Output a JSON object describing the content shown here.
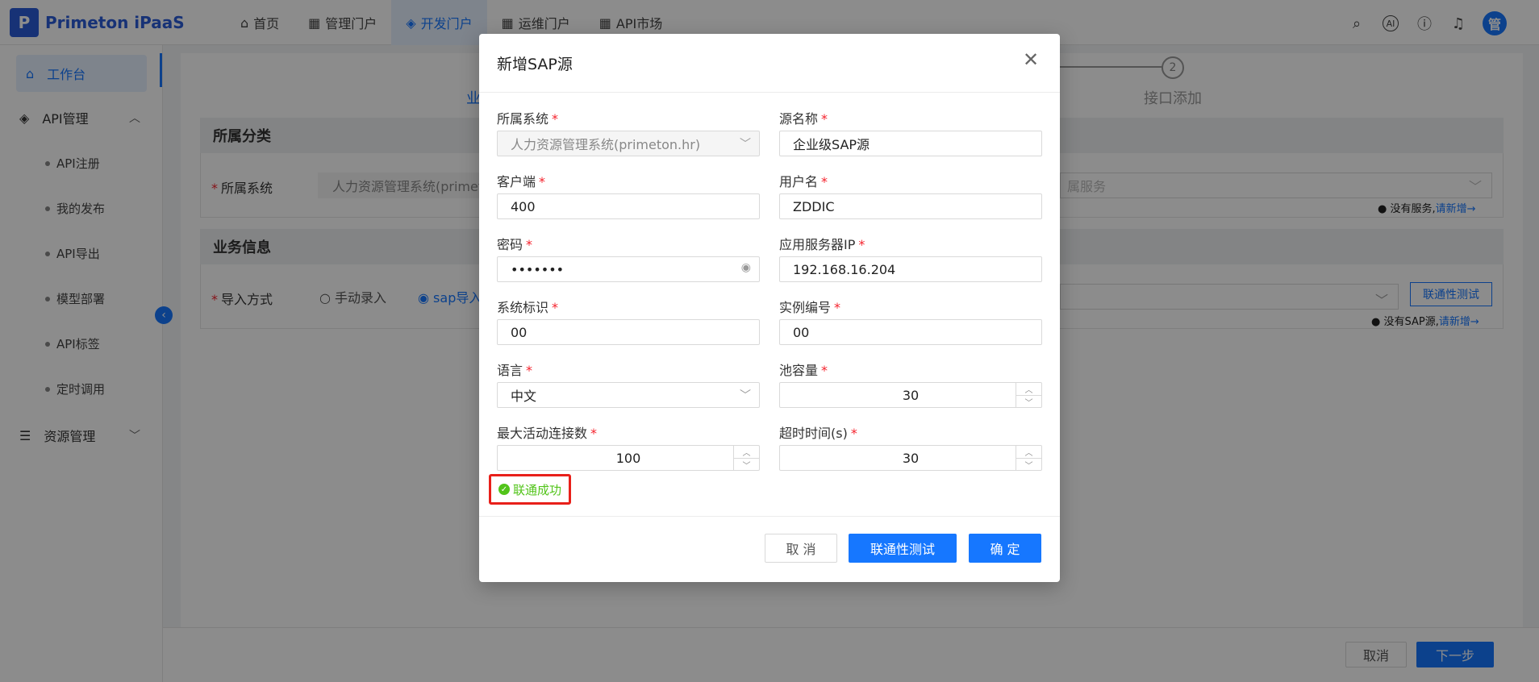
{
  "app": {
    "logo_letter": "P",
    "logo_text": "Primeton iPaaS",
    "user_avatar": "管"
  },
  "topnav": [
    {
      "label": "首页",
      "icon": "home-icon"
    },
    {
      "label": "管理门户",
      "icon": "grid-icon"
    },
    {
      "label": "开发门户",
      "icon": "layers-icon",
      "active": true
    },
    {
      "label": "运维门户",
      "icon": "grid-icon"
    },
    {
      "label": "API市场",
      "icon": "grid-icon"
    }
  ],
  "top_tools": [
    "search-icon",
    "ai-icon",
    "help-icon",
    "bell-icon"
  ],
  "ai_label": "AI",
  "sidebar": {
    "active": "工作台",
    "api_group": "API管理",
    "items": [
      "API注册",
      "我的发布",
      "API导出",
      "模型部署",
      "API标签",
      "定时调用"
    ],
    "resource_group": "资源管理"
  },
  "background": {
    "step_partial": "业",
    "step2_number": "2",
    "step2_label": "接口添加",
    "section1_title": "所属分类",
    "section1_field_label": "所属系统",
    "section1_field_value": "人力资源管理系统(primeto",
    "service_placeholder": "属服务",
    "no_service_text": "没有服务,",
    "new_link": "请新增→",
    "section2_title": "业务信息",
    "import_label": "导入方式",
    "radio_manual": "手动录入",
    "radio_sap": "sap导入",
    "connect_test_btn": "联通性测试",
    "no_sap_text": "没有SAP源,",
    "footer_cancel": "取消",
    "footer_next": "下一步"
  },
  "modal": {
    "title": "新增SAP源",
    "fields": {
      "system_label": "所属系统",
      "system_value": "人力资源管理系统(primeton.hr)",
      "source_name_label": "源名称",
      "source_name_value": "企业级SAP源",
      "client_label": "客户端",
      "client_value": "400",
      "username_label": "用户名",
      "username_value": "ZDDIC",
      "password_label": "密码",
      "password_value": "•••••••",
      "server_ip_label": "应用服务器IP",
      "server_ip_value": "192.168.16.204",
      "sysid_label": "系统标识",
      "sysid_value": "00",
      "instance_label": "实例编号",
      "instance_value": "00",
      "language_label": "语言",
      "language_value": "中文",
      "pool_label": "池容量",
      "pool_value": "30",
      "max_conn_label": "最大活动连接数",
      "max_conn_value": "100",
      "timeout_label": "超时时间(s)",
      "timeout_value": "30"
    },
    "success_text": "联通成功",
    "cancel_btn": "取 消",
    "test_btn": "联通性测试",
    "ok_btn": "确 定"
  },
  "colors": {
    "primary": "#1677ff",
    "success": "#52c41a",
    "required": "#f5222d",
    "highlight": "#e8201a"
  }
}
